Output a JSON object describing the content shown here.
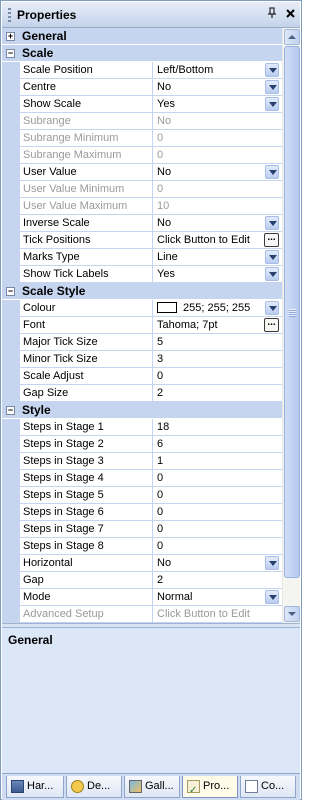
{
  "panel": {
    "title": "Properties",
    "pin_icon": "pin-icon",
    "close_icon": "close-icon"
  },
  "categories": {
    "general": {
      "label": "General",
      "toggle": "+"
    },
    "scale": {
      "label": "Scale",
      "toggle": "−"
    },
    "scale_style": {
      "label": "Scale Style",
      "toggle": "−"
    },
    "style": {
      "label": "Style",
      "toggle": "−"
    }
  },
  "scale_rows": [
    {
      "name": "Scale Position",
      "value": "Left/Bottom",
      "editor": "dropdown",
      "enabled": true
    },
    {
      "name": "Centre",
      "value": "No",
      "editor": "dropdown",
      "enabled": true
    },
    {
      "name": "Show Scale",
      "value": "Yes",
      "editor": "dropdown",
      "enabled": true
    },
    {
      "name": "Subrange",
      "value": "No",
      "editor": "none",
      "enabled": false
    },
    {
      "name": "Subrange Minimum",
      "value": "0",
      "editor": "none",
      "enabled": false
    },
    {
      "name": "Subrange Maximum",
      "value": "0",
      "editor": "none",
      "enabled": false
    },
    {
      "name": "User Value",
      "value": "No",
      "editor": "dropdown",
      "enabled": true
    },
    {
      "name": "User Value Minimum",
      "value": "0",
      "editor": "none",
      "enabled": false
    },
    {
      "name": "User Value Maximum",
      "value": "10",
      "editor": "none",
      "enabled": false
    },
    {
      "name": "Inverse Scale",
      "value": "No",
      "editor": "dropdown",
      "enabled": true
    },
    {
      "name": "Tick Positions",
      "value": "Click Button to Edit",
      "editor": "ellipsis",
      "enabled": true
    },
    {
      "name": "Marks Type",
      "value": "Line",
      "editor": "dropdown",
      "enabled": true
    },
    {
      "name": "Show Tick Labels",
      "value": "Yes",
      "editor": "dropdown",
      "enabled": true
    }
  ],
  "scale_style_rows": [
    {
      "name": "Colour",
      "value": "255; 255; 255",
      "editor": "dropdown",
      "enabled": true,
      "swatch": "#ffffff"
    },
    {
      "name": "Font",
      "value": "Tahoma; 7pt",
      "editor": "ellipsis",
      "enabled": true
    },
    {
      "name": "Major Tick Size",
      "value": "5",
      "editor": "none",
      "enabled": true
    },
    {
      "name": "Minor Tick Size",
      "value": "3",
      "editor": "none",
      "enabled": true
    },
    {
      "name": "Scale Adjust",
      "value": "0",
      "editor": "none",
      "enabled": true
    },
    {
      "name": "Gap Size",
      "value": "2",
      "editor": "none",
      "enabled": true
    }
  ],
  "style_rows": [
    {
      "name": "Steps in Stage 1",
      "value": "18",
      "editor": "none",
      "enabled": true
    },
    {
      "name": "Steps in Stage 2",
      "value": "6",
      "editor": "none",
      "enabled": true
    },
    {
      "name": "Steps in Stage 3",
      "value": "1",
      "editor": "none",
      "enabled": true
    },
    {
      "name": "Steps in Stage 4",
      "value": "0",
      "editor": "none",
      "enabled": true
    },
    {
      "name": "Steps in Stage 5",
      "value": "0",
      "editor": "none",
      "enabled": true
    },
    {
      "name": "Steps in Stage 6",
      "value": "0",
      "editor": "none",
      "enabled": true
    },
    {
      "name": "Steps in Stage 7",
      "value": "0",
      "editor": "none",
      "enabled": true
    },
    {
      "name": "Steps in Stage 8",
      "value": "0",
      "editor": "none",
      "enabled": true
    },
    {
      "name": "Horizontal",
      "value": "No",
      "editor": "dropdown",
      "enabled": true
    },
    {
      "name": "Gap",
      "value": "2",
      "editor": "none",
      "enabled": true
    },
    {
      "name": "Mode",
      "value": "Normal",
      "editor": "dropdown",
      "enabled": true
    },
    {
      "name": "Advanced Setup",
      "value": "Click Button to Edit",
      "editor": "none",
      "enabled": false
    }
  ],
  "description": {
    "title": "General"
  },
  "tabs": [
    {
      "label": "Har...",
      "icon": "hardware-icon",
      "active": false
    },
    {
      "label": "De...",
      "icon": "device-icon",
      "active": false
    },
    {
      "label": "Gall...",
      "icon": "gallery-icon",
      "active": false
    },
    {
      "label": "Pro...",
      "icon": "properties-icon",
      "active": true
    },
    {
      "label": "Co...",
      "icon": "console-icon",
      "active": false
    }
  ],
  "colors": {
    "category_bg": "#c5d4ef",
    "grid_line": "#c5d4ef",
    "disabled_text": "#9a9a9a",
    "description_bg": "#dbe6f7"
  }
}
